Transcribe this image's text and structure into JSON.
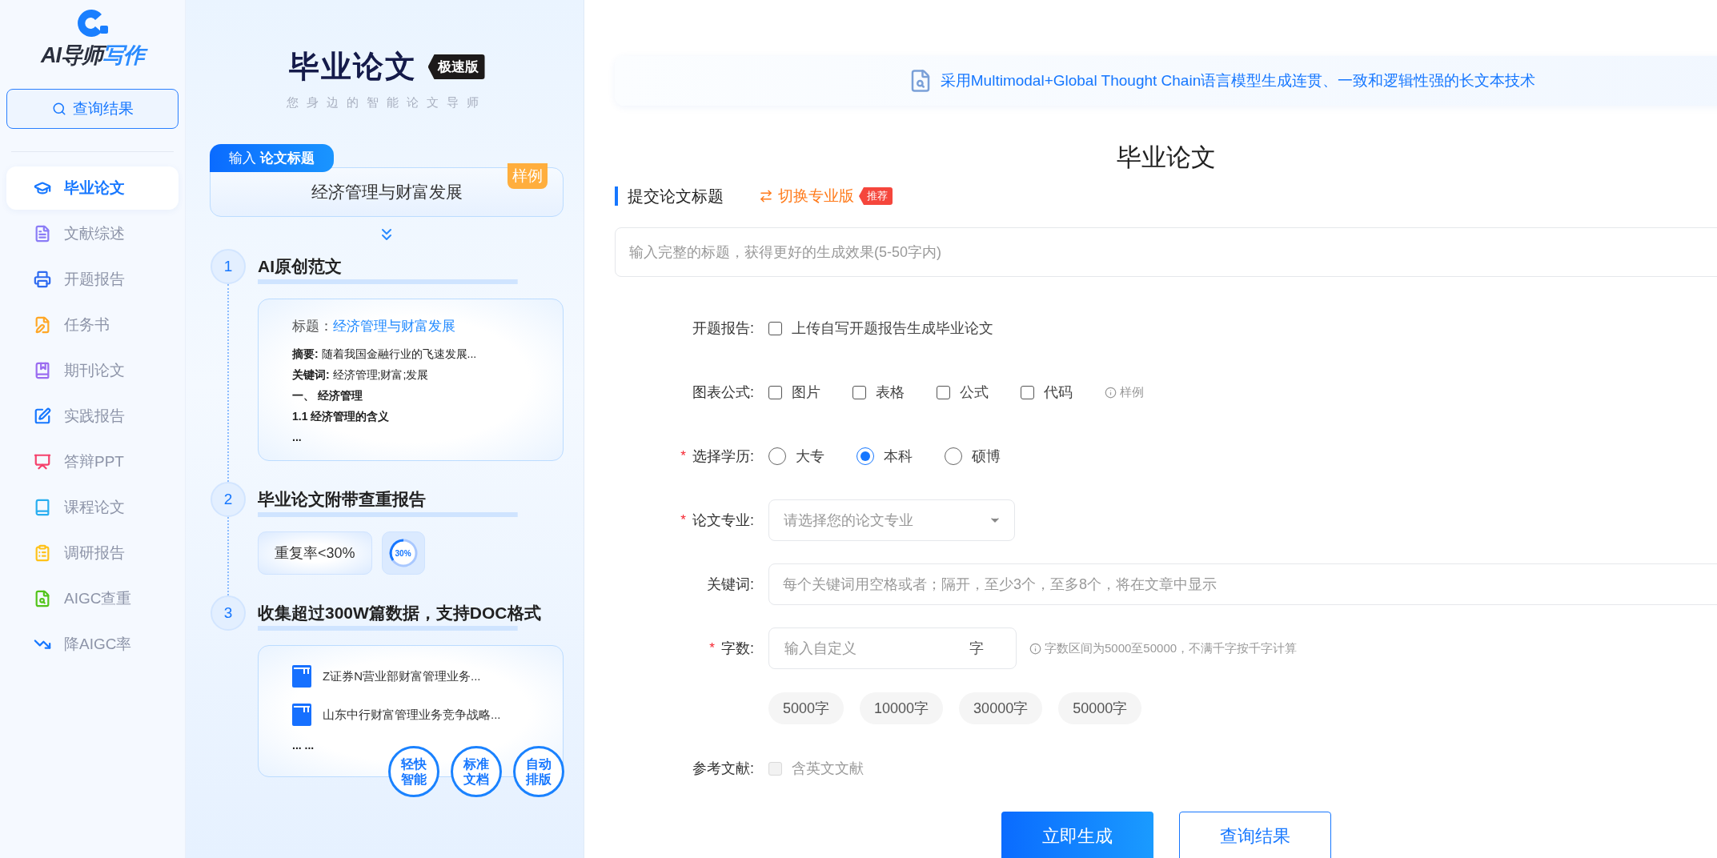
{
  "sidebar": {
    "logo": {
      "primary": "AI导师",
      "accent": "写作"
    },
    "search_button": "查询结果",
    "items": [
      {
        "label": "毕业论文",
        "selected": true,
        "color": "#1677ff"
      },
      {
        "label": "文献综述",
        "selected": false,
        "color": "#8b7cf6"
      },
      {
        "label": "开题报告",
        "selected": false,
        "color": "#2f6bf0"
      },
      {
        "label": "任务书",
        "selected": false,
        "color": "#ffa726"
      },
      {
        "label": "期刊论文",
        "selected": false,
        "color": "#9b6cf0"
      },
      {
        "label": "实践报告",
        "selected": false,
        "color": "#1677ff"
      },
      {
        "label": "答辩PPT",
        "selected": false,
        "color": "#f5416c"
      },
      {
        "label": "课程论文",
        "selected": false,
        "color": "#29aef0"
      },
      {
        "label": "调研报告",
        "selected": false,
        "color": "#ffc21a"
      },
      {
        "label": "AIGC查重",
        "selected": false,
        "color": "#52c41a"
      },
      {
        "label": "降AIGC率",
        "selected": false,
        "color": "#1677ff"
      }
    ]
  },
  "intro": {
    "title": "毕业论文",
    "edition_badge": "极速版",
    "tagline": "您身边的智能论文导师",
    "input_card": {
      "tab_prefix": "输入",
      "tab_bold": "论文标题",
      "value": "经济管理与财富发展",
      "sample_badge": "样例"
    },
    "steps": [
      {
        "number": "1",
        "title": "AI原创范文",
        "kind": "outline",
        "title_label": "标题：",
        "title_value": "经济管理与财富发展",
        "lines": [
          {
            "text": "**摘要:** 随着我国金融行业的飞速发展...",
            "bold": false
          },
          {
            "text": "**关键词:** 经济管理;财富;发展",
            "bold": false
          },
          {
            "text": "一、 经济管理",
            "bold": true
          },
          {
            "text": "1.1 经济管理的含义",
            "bold": true
          },
          {
            "text": "...",
            "bold": true
          }
        ]
      },
      {
        "number": "2",
        "title": "毕业论文附带查重报告",
        "kind": "report",
        "pill": "重复率<30%",
        "ring": "30%"
      },
      {
        "number": "3",
        "title": "收集超过300W篇数据，支持DOC格式",
        "kind": "docs",
        "docs": [
          "Z证券N营业部财富管理业务...",
          "山东中行财富管理业务竞争战略..."
        ],
        "more": "... ...",
        "badges": [
          "轻快智能",
          "标准文档",
          "自动排版"
        ]
      }
    ]
  },
  "main": {
    "banner": "采用Multimodal+Global Thought Chain语言模型生成连贯、一致和逻辑性强的长文本技术",
    "heading": "毕业论文",
    "section_title": "提交论文标题",
    "switch_link": "切换专业版",
    "switch_badge": "推荐",
    "title_field": {
      "placeholder": "输入完整的标题，获得更好的生成效果(5-50字内)"
    },
    "rows": [
      {
        "kind": "checkboxes",
        "label": "开题报告:",
        "options": [
          {
            "label": "上传自写开题报告生成毕业论文",
            "checked": false,
            "disabled": false
          }
        ]
      },
      {
        "kind": "checkboxes",
        "label": "图表公式:",
        "options": [
          {
            "label": "图片",
            "checked": false,
            "disabled": false
          },
          {
            "label": "表格",
            "checked": false,
            "disabled": false
          },
          {
            "label": "公式",
            "checked": false,
            "disabled": false
          },
          {
            "label": "代码",
            "checked": false,
            "disabled": false
          }
        ],
        "hint": "样例"
      },
      {
        "kind": "radios",
        "label": "选择学历:",
        "required_mark": "*",
        "options": [
          {
            "label": "大专",
            "selected": false
          },
          {
            "label": "本科",
            "selected": true
          },
          {
            "label": "硕博",
            "selected": false
          }
        ]
      },
      {
        "kind": "select",
        "label": "论文专业:",
        "required_mark": "*",
        "placeholder": "请选择您的论文专业"
      },
      {
        "kind": "text",
        "label": "关键词:",
        "placeholder": "每个关键词用空格或者；隔开，至少3个，至多8个，将在文章中显示"
      },
      {
        "kind": "count",
        "label": "字数:",
        "required_mark": "*",
        "placeholder": "输入自定义",
        "unit": "字",
        "hint": "字数区间为5000至50000，不满千字按千字计算"
      },
      {
        "kind": "chips",
        "chips": [
          "5000字",
          "10000字",
          "30000字",
          "50000字"
        ]
      },
      {
        "kind": "checkboxes",
        "label": "参考文献:",
        "options": [
          {
            "label": "含英文文献",
            "checked": false,
            "disabled": true
          }
        ]
      }
    ],
    "buttons": [
      {
        "label": "立即生成",
        "kind": "primary"
      },
      {
        "label": "查询结果",
        "kind": "secondary"
      }
    ]
  }
}
